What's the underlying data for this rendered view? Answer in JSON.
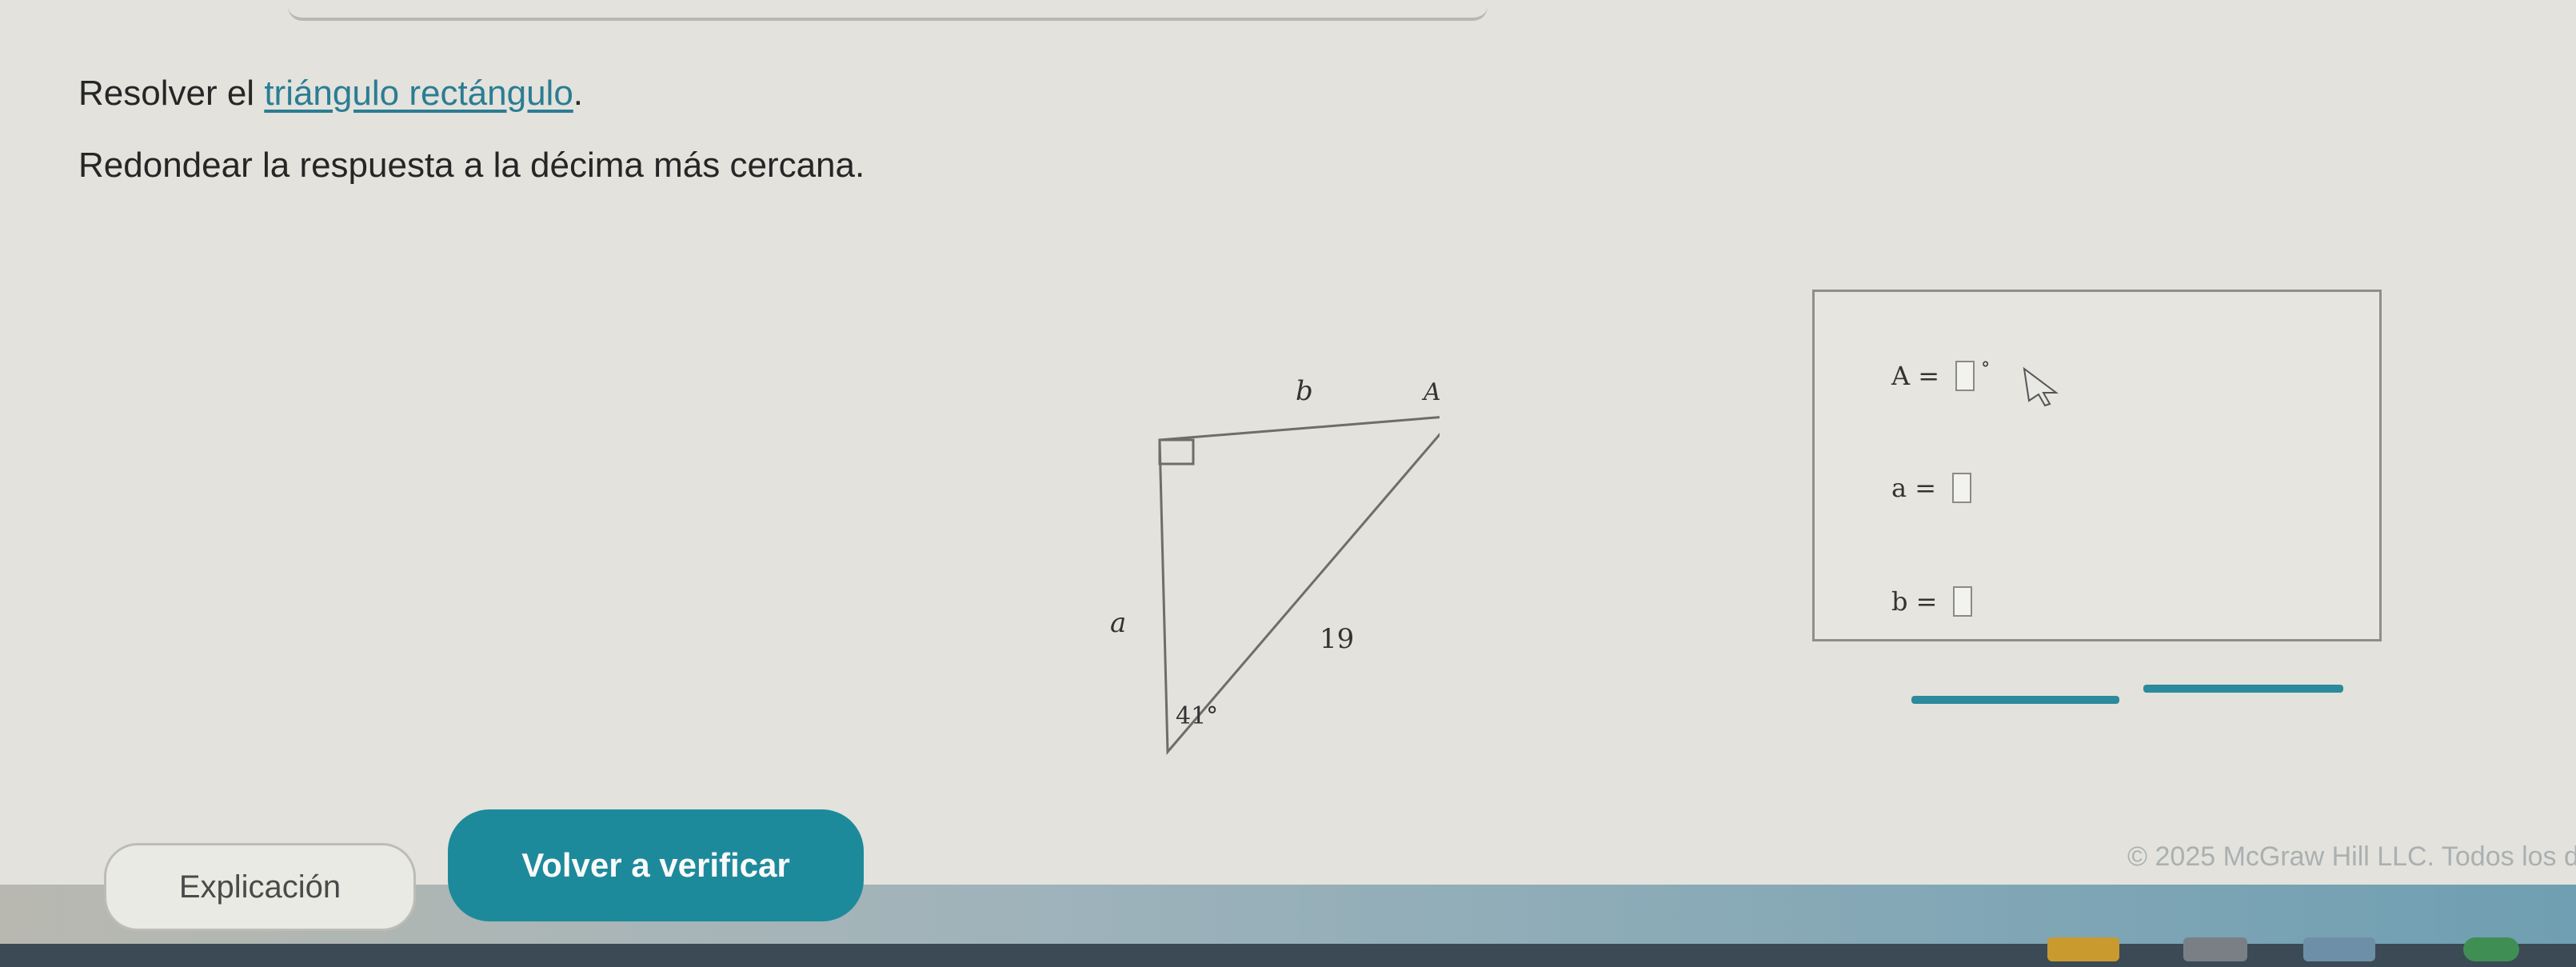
{
  "instructions": {
    "line1_prefix": "Resolver el ",
    "line1_link": "triángulo rectángulo",
    "line1_suffix": ".",
    "line2": "Redondear la respuesta a la décima más cercana."
  },
  "figure": {
    "label_b": "b",
    "label_A": "A",
    "label_a": "a",
    "hypotenuse": "19",
    "angle": "41°"
  },
  "answers": {
    "A_label": "A =",
    "A_unit": "°",
    "a_label": "a =",
    "b_label": "b ="
  },
  "buttons": {
    "explain": "Explicación",
    "verify": "Volver a verificar"
  },
  "footer": {
    "copyright": "© 2025 McGraw Hill LLC. Todos los d"
  },
  "colors": {
    "accent": "#1d8a9b",
    "link": "#2a7d93",
    "background": "#e3e2dc"
  }
}
